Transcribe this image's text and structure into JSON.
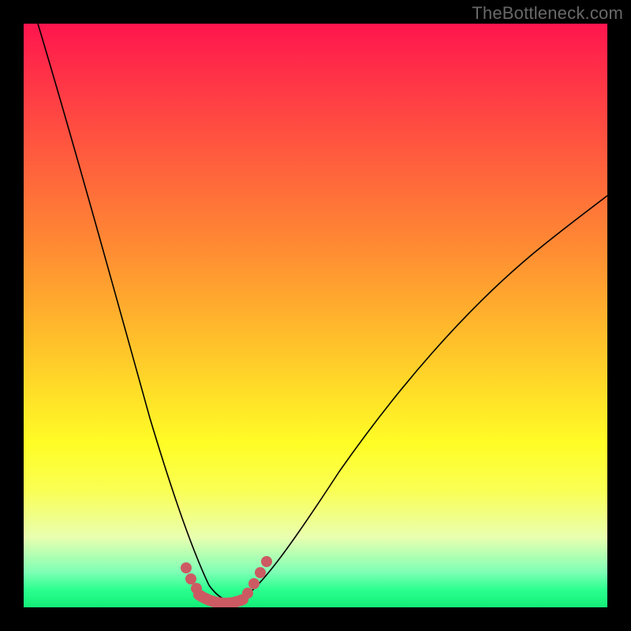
{
  "watermark": "TheBottleneck.com",
  "chart_data": {
    "type": "line",
    "title": "",
    "xlabel": "",
    "ylabel": "",
    "xlim": [
      0,
      100
    ],
    "ylim": [
      0,
      100
    ],
    "grid": false,
    "legend": false,
    "series": [
      {
        "name": "bottleneck-curve",
        "x": [
          2,
          6,
          10,
          14,
          18,
          22,
          26,
          28,
          30,
          32,
          34,
          36,
          38,
          42,
          48,
          56,
          64,
          72,
          80,
          88,
          96,
          100
        ],
        "values": [
          100,
          88,
          76,
          64,
          52,
          38,
          22,
          14,
          8,
          4,
          2,
          2,
          4,
          10,
          20,
          32,
          42,
          50,
          56,
          60,
          63,
          64
        ]
      }
    ],
    "markers": {
      "name": "emphasis-dots",
      "x": [
        26.5,
        27.5,
        29,
        31,
        33,
        35,
        37,
        38.5,
        39.5,
        40.5
      ],
      "values": [
        20,
        14,
        8,
        4,
        2,
        2,
        4,
        8,
        12,
        17
      ]
    },
    "colors": {
      "curve": "#000000",
      "markers": "#cc5a63",
      "gradient_top": "#ff154e",
      "gradient_mid": "#fffd26",
      "gradient_bottom": "#13ee78"
    }
  }
}
